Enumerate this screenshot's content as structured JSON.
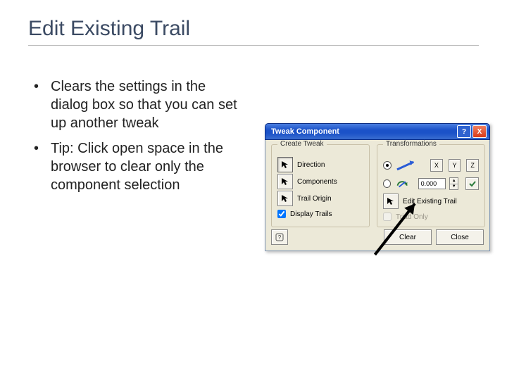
{
  "title": "Edit Existing Trail",
  "bullets": [
    "Clears the settings in the dialog box so that you can set up another tweak",
    "Tip: Click open space in the browser to clear only the component selection"
  ],
  "dialog": {
    "title": "Tweak Component",
    "titlebar": {
      "help": "?",
      "close": "X"
    },
    "groups": {
      "create": {
        "label": "Create Tweak",
        "rows": {
          "direction": "Direction",
          "components": "Components",
          "trail_origin": "Trail Origin"
        },
        "display_trails": "Display Trails"
      },
      "transform": {
        "label": "Transformations",
        "axes": {
          "x": "X",
          "y": "Y",
          "z": "Z"
        },
        "value": "0.000",
        "edit_existing": "Edit Existing Trail",
        "triad_only": "Triad Only"
      }
    },
    "buttons": {
      "help": "?",
      "clear": "Clear",
      "close": "Close"
    }
  }
}
